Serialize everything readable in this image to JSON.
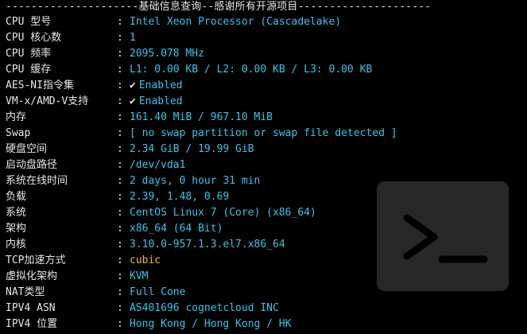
{
  "header": {
    "text": "---------------------基础信息查询--感谢所有开源项目---------------------"
  },
  "rows": [
    {
      "label": "CPU 型号",
      "value": "Intel Xeon Processor (Cascadelake)"
    },
    {
      "label": "CPU 核心数",
      "value": "1"
    },
    {
      "label": "CPU 频率",
      "value": "2095.078 MHz"
    },
    {
      "label": "CPU 缓存",
      "value": "L1: 0.00 KB / L2: 0.00 KB / L3: 0.00 KB"
    },
    {
      "label": "AES-NI指令集",
      "check": "✔",
      "value": "Enabled"
    },
    {
      "label": "VM-x/AMD-V支持",
      "check": "✔",
      "value": "Enabled"
    },
    {
      "label": "内存",
      "value": "161.40 MiB / 967.10 MiB"
    },
    {
      "label": "Swap",
      "value": "[ no swap partition or swap file detected ]"
    },
    {
      "label": "硬盘空间",
      "value": "2.34 GiB / 19.99 GiB"
    },
    {
      "label": "启动盘路径",
      "value": "/dev/vda1"
    },
    {
      "label": "系统在线时间",
      "value": "2 days, 0 hour 31 min"
    },
    {
      "label": "负载",
      "value": "2.39, 1.48, 0.69"
    },
    {
      "label": "系统",
      "value": "CentOS Linux 7 (Core) (x86_64)"
    },
    {
      "label": "架构",
      "value": "x86_64 (64 Bit)"
    },
    {
      "label": "内核",
      "value": "3.10.0-957.1.3.el7.x86_64"
    },
    {
      "label": "TCP加速方式",
      "value": "cubic"
    },
    {
      "label": "虚拟化架构",
      "value": "KVM"
    },
    {
      "label": "NAT类型",
      "value": "Full Cone"
    },
    {
      "label": "IPV4 ASN",
      "value": "AS401696 cognetcloud INC"
    },
    {
      "label": "IPV4 位置",
      "value": "Hong Kong / Hong Kong / HK"
    }
  ],
  "separator": ":",
  "colors": {
    "background": "#000000",
    "label": "#e6e6e6",
    "value": "#35c6e8",
    "highlight": "#f0c020",
    "watermark": "#2f2f2f"
  },
  "watermark_icon": "terminal-prompt-icon"
}
